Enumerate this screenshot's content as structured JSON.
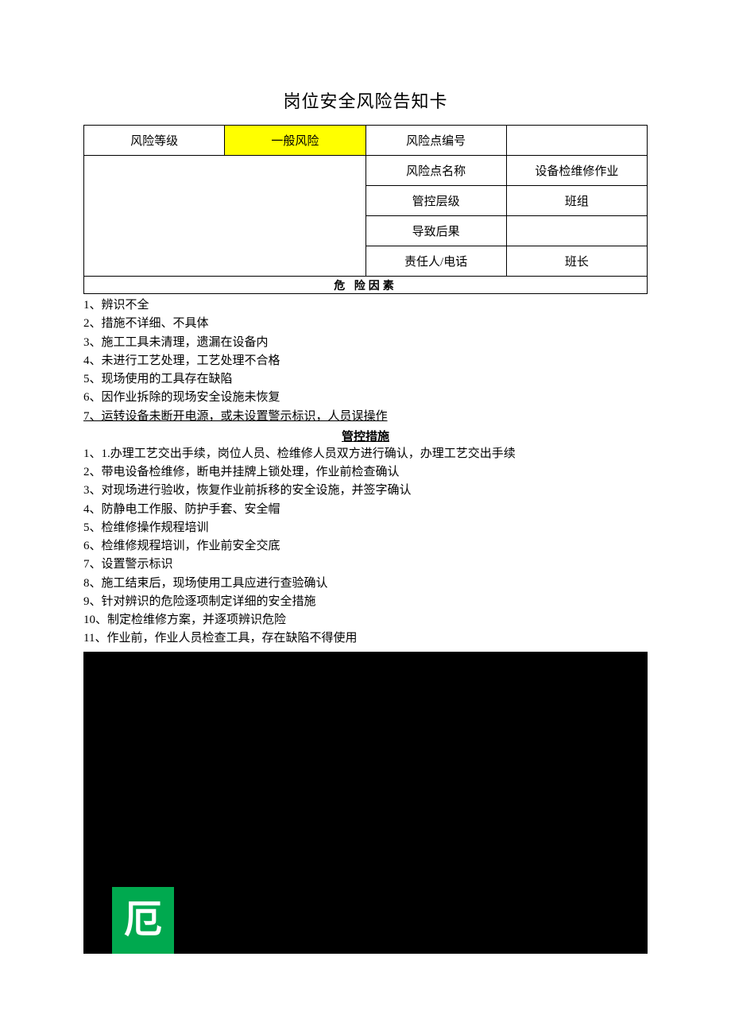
{
  "title": "岗位安全风险告知卡",
  "table": {
    "risk_level_label": "风险等级",
    "risk_level_value": "一般风险",
    "risk_point_no_label": "风险点编号",
    "risk_point_no_value": "",
    "risk_point_name_label": "风险点名称",
    "risk_point_name_value": "设备检维修作业",
    "control_level_label": "管控层级",
    "control_level_value": "班组",
    "consequence_label": "导致后果",
    "consequence_value": "",
    "responsible_label": "责任人/电话",
    "responsible_value": "班长"
  },
  "hazard_header": "危 险因素",
  "hazards": [
    "1、辨识不全",
    "2、措施不详细、不具体",
    "3、施工工具未清理，遗漏在设备内",
    "4、未进行工艺处理，工艺处理不合格",
    "5、现场使用的工具存在缺陷",
    "6、因作业拆除的现场安全设施未恢复",
    "7、运转设备未断开电源，或未设置警示标识，人员误操作"
  ],
  "measures_header": "管控措施",
  "measures": [
    "1、1.办理工艺交出手续，岗位人员、检维修人员双方进行确认，办理工艺交出手续",
    "2、带电设备检维修，断电并挂牌上锁处理，作业前检查确认",
    "3、对现场进行验收，恢复作业前拆移的安全设施，并签字确认",
    "4、防静电工作服、防护手套、安全帽",
    "5、检维修操作规程培训",
    "6、检维修规程培训，作业前安全交底",
    "7、设置警示标识",
    "8、施工结束后，现场使用工具应进行查验确认",
    "9、针对辨识的危险逐项制定详细的安全措施",
    "10、制定检维修方案，并逐项辨识危险",
    "11、作业前，作业人员检查工具，存在缺陷不得使用"
  ],
  "badge_char": "厄"
}
